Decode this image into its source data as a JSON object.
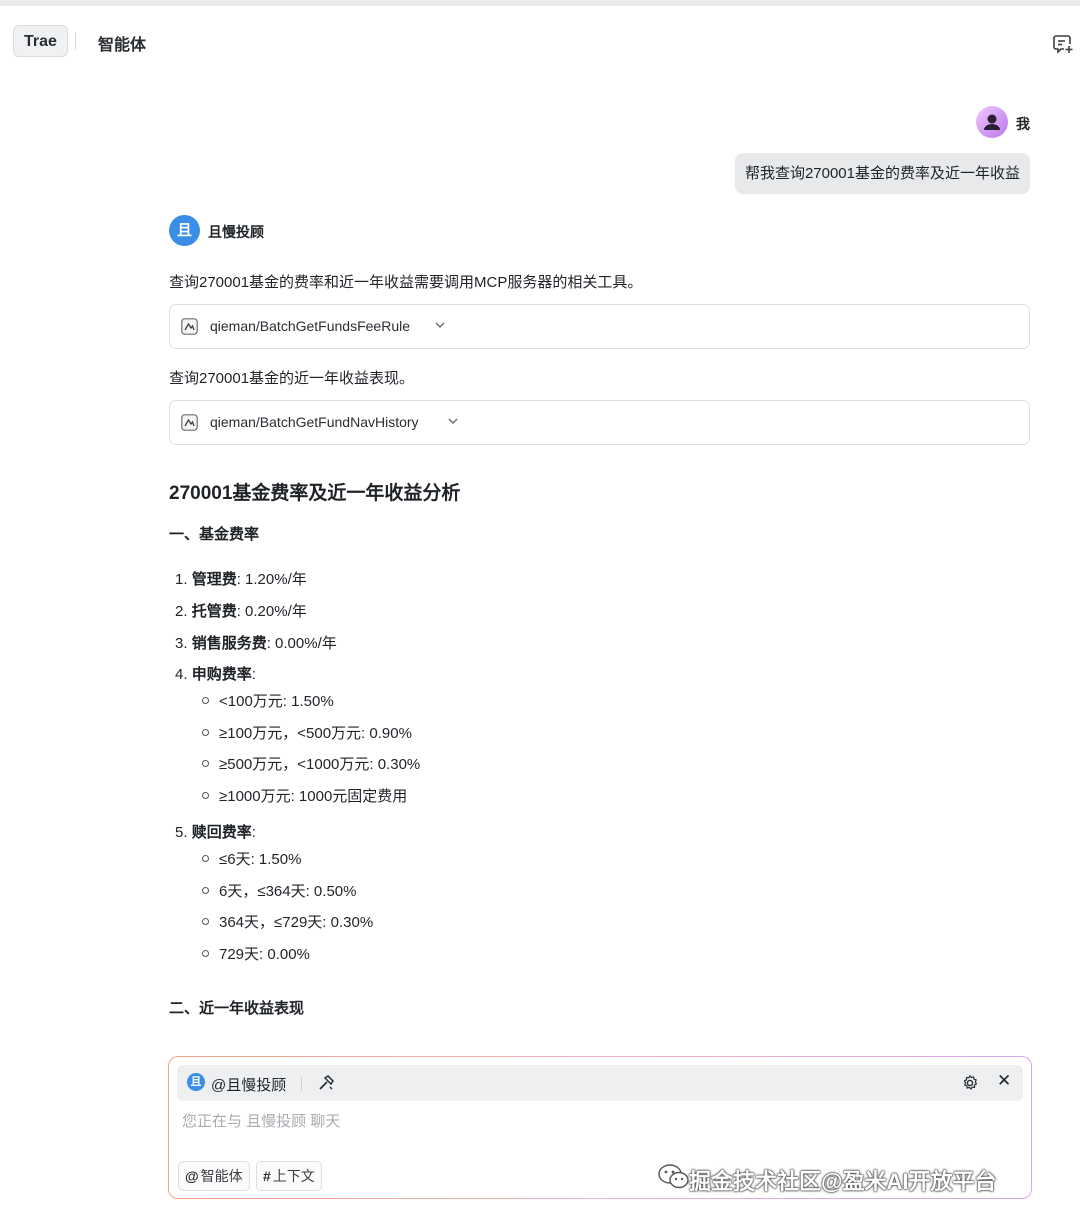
{
  "header": {
    "tab_trae": "Trae",
    "tab_agent": "智能体"
  },
  "user": {
    "name": "我",
    "message": "帮我查询270001基金的费率及近一年收益"
  },
  "assistant": {
    "name": "且慢投顾",
    "avatar_char": "且",
    "intro1": "查询270001基金的费率和近一年收益需要调用MCP服务器的相关工具。",
    "tool1": "qieman/BatchGetFundsFeeRule",
    "intro2": "查询270001基金的近一年收益表现。",
    "tool2": "qieman/BatchGetFundNavHistory",
    "heading": "270001基金费率及近一年收益分析",
    "section1": "一、基金费率",
    "fees": [
      {
        "num": "1.",
        "label": "管理费",
        "value": ": 1.20%/年"
      },
      {
        "num": "2.",
        "label": "托管费",
        "value": ": 0.20%/年"
      },
      {
        "num": "3.",
        "label": "销售服务费",
        "value": ": 0.00%/年"
      },
      {
        "num": "4.",
        "label": "申购费率",
        "value": ":"
      }
    ],
    "purchase": [
      "<100万元: 1.50%",
      "≥100万元，<500万元: 0.90%",
      "≥500万元，<1000万元: 0.30%",
      "≥1000万元: 1000元固定费用"
    ],
    "redeem_item": {
      "num": "5.",
      "label": "赎回费率",
      "value": ":"
    },
    "redeem": [
      "≤6天: 1.50%",
      "6天，≤364天: 0.50%",
      "364天，≤729天: 0.30%",
      "729天: 0.00%"
    ],
    "section2": "二、近一年收益表现"
  },
  "composer": {
    "agent_label": "@且慢投顾",
    "agent_char": "且",
    "placeholder": "您正在与 且慢投顾 聊天",
    "chip_agent": "智能体",
    "chip_context": "上下文",
    "chip_agent_sym": "@",
    "chip_context_sym": "#",
    "close_symbol": "✕"
  },
  "watermark": {
    "text": "掘金技术社区@盈米AI开放平台"
  },
  "colors": {
    "accent_blue": "#3a8ee6",
    "bubble_bg": "#e8e9eb",
    "composer_gradient": [
      "#f6a38a",
      "#f3b3c0",
      "#d6a7ef"
    ]
  }
}
